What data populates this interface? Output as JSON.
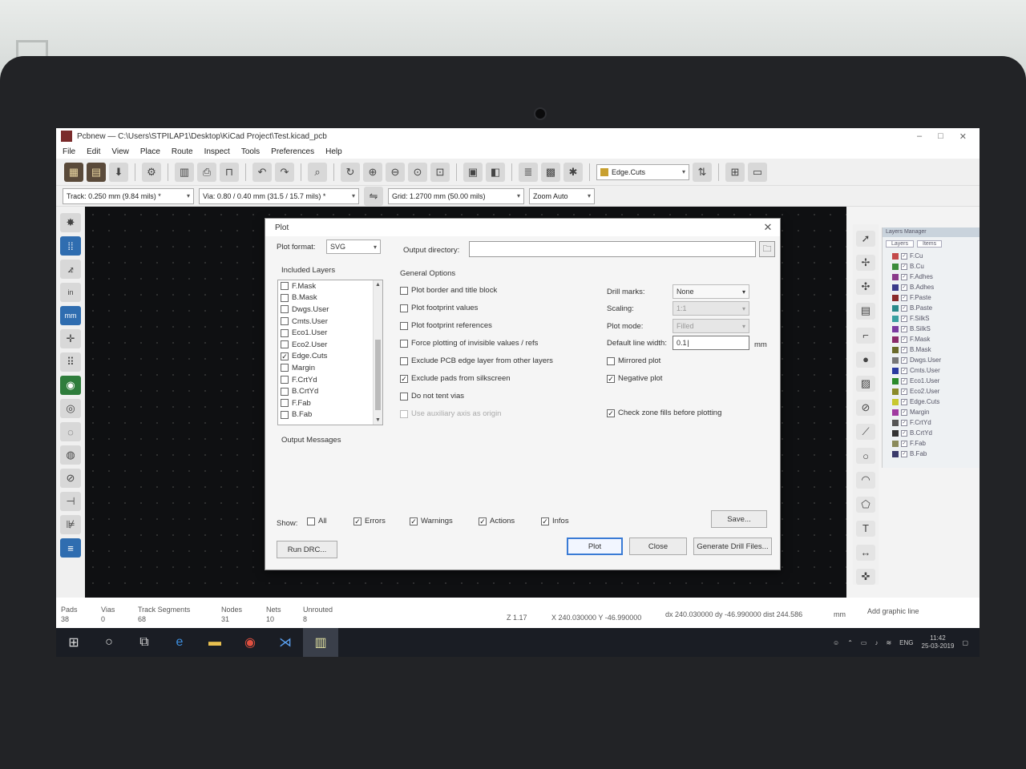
{
  "window": {
    "title": "Pcbnew — C:\\Users\\STPILAP1\\Desktop\\KiCad Project\\Test.kicad_pcb"
  },
  "menu": [
    "File",
    "Edit",
    "View",
    "Place",
    "Route",
    "Inspect",
    "Tools",
    "Preferences",
    "Help"
  ],
  "toolbar": {
    "layer_select": "Edge.Cuts",
    "track_select": "Track: 0.250 mm (9.84 mils) *",
    "via_select": "Via: 0.80 / 0.40 mm (31.5 / 15.7 mils) *",
    "grid_select": "Grid: 1.2700 mm (50.00 mils)",
    "zoom_select": "Zoom Auto"
  },
  "left_tools": {
    "inch_label": "in",
    "mm_label": "mm"
  },
  "layers_manager": {
    "title": "Layers Manager",
    "tabs": [
      "Layers",
      "Items"
    ],
    "layers": [
      {
        "name": "F.Cu",
        "color": "#c44a4a"
      },
      {
        "name": "B.Cu",
        "color": "#3b8c3b"
      },
      {
        "name": "F.Adhes",
        "color": "#8a3a8a"
      },
      {
        "name": "B.Adhes",
        "color": "#3a3a8a"
      },
      {
        "name": "F.Paste",
        "color": "#8a2a2a"
      },
      {
        "name": "B.Paste",
        "color": "#2a8a8a"
      },
      {
        "name": "F.SilkS",
        "color": "#3aa0a0"
      },
      {
        "name": "B.SilkS",
        "color": "#7a3aa0"
      },
      {
        "name": "F.Mask",
        "color": "#8a2a6a"
      },
      {
        "name": "B.Mask",
        "color": "#6a6a2a"
      },
      {
        "name": "Dwgs.User",
        "color": "#777777"
      },
      {
        "name": "Cmts.User",
        "color": "#2a3aa0"
      },
      {
        "name": "Eco1.User",
        "color": "#2a8a2a"
      },
      {
        "name": "Eco2.User",
        "color": "#8a8a2a"
      },
      {
        "name": "Edge.Cuts",
        "color": "#c8c830"
      },
      {
        "name": "Margin",
        "color": "#a03aa0"
      },
      {
        "name": "F.CrtYd",
        "color": "#555555"
      },
      {
        "name": "B.CrtYd",
        "color": "#333333"
      },
      {
        "name": "F.Fab",
        "color": "#8a8a5a"
      },
      {
        "name": "B.Fab",
        "color": "#3a3a6a"
      }
    ]
  },
  "dialog": {
    "title": "Plot",
    "plot_format_label": "Plot format:",
    "plot_format_value": "SVG",
    "output_dir_label": "Output directory:",
    "output_dir_value": "",
    "included_layers_label": "Included Layers",
    "included_layers": [
      {
        "name": "F.Mask",
        "checked": false
      },
      {
        "name": "B.Mask",
        "checked": false
      },
      {
        "name": "Dwgs.User",
        "checked": false
      },
      {
        "name": "Cmts.User",
        "checked": false
      },
      {
        "name": "Eco1.User",
        "checked": false
      },
      {
        "name": "Eco2.User",
        "checked": false
      },
      {
        "name": "Edge.Cuts",
        "checked": true
      },
      {
        "name": "Margin",
        "checked": false
      },
      {
        "name": "F.CrtYd",
        "checked": false
      },
      {
        "name": "B.CrtYd",
        "checked": false
      },
      {
        "name": "F.Fab",
        "checked": false
      },
      {
        "name": "B.Fab",
        "checked": false
      }
    ],
    "general_options_label": "General Options",
    "options": [
      {
        "label": "Plot border and title block",
        "checked": false,
        "disabled": false
      },
      {
        "label": "Plot footprint values",
        "checked": false,
        "disabled": false
      },
      {
        "label": "Plot footprint references",
        "checked": false,
        "disabled": false
      },
      {
        "label": "Force plotting of invisible values / refs",
        "checked": false,
        "disabled": false
      },
      {
        "label": "Exclude PCB edge layer from other layers",
        "checked": false,
        "disabled": false
      },
      {
        "label": "Exclude pads from silkscreen",
        "checked": true,
        "disabled": false
      },
      {
        "label": "Do not tent vias",
        "checked": false,
        "disabled": false
      },
      {
        "label": "Use auxiliary axis as origin",
        "checked": false,
        "disabled": true
      }
    ],
    "drill_marks_label": "Drill marks:",
    "drill_marks_value": "None",
    "scaling_label": "Scaling:",
    "scaling_value": "1:1",
    "plot_mode_label": "Plot mode:",
    "plot_mode_value": "Filled",
    "line_width_label": "Default line width:",
    "line_width_value": "0.1",
    "line_width_unit": "mm",
    "mirrored_label": "Mirrored plot",
    "mirrored_checked": false,
    "negative_label": "Negative plot",
    "negative_checked": true,
    "zone_fills_label": "Check zone fills before plotting",
    "zone_fills_checked": true,
    "output_messages_label": "Output Messages",
    "show_label": "Show:",
    "filters": [
      {
        "label": "All",
        "checked": false
      },
      {
        "label": "Errors",
        "checked": true
      },
      {
        "label": "Warnings",
        "checked": true
      },
      {
        "label": "Actions",
        "checked": true
      },
      {
        "label": "Infos",
        "checked": true
      }
    ],
    "save_label": "Save...",
    "run_drc_label": "Run DRC...",
    "plot_label": "Plot",
    "close_label": "Close",
    "drill_files_label": "Generate Drill Files..."
  },
  "status": {
    "pads_label": "Pads",
    "pads_value": "38",
    "vias_label": "Vias",
    "vias_value": "0",
    "tracks_label": "Track Segments",
    "tracks_value": "68",
    "nodes_label": "Nodes",
    "nodes_value": "31",
    "nets_label": "Nets",
    "nets_value": "10",
    "unrouted_label": "Unrouted",
    "unrouted_value": "8",
    "zoom": "Z 1.17",
    "coords": "X 240.030000  Y -46.990000",
    "delta": "dx 240.030000  dy -46.990000  dist 244.586",
    "units": "mm",
    "mode": "Add graphic line"
  },
  "taskbar": {
    "lang": "ENG",
    "time": "11:42",
    "date": "25-03-2019"
  }
}
